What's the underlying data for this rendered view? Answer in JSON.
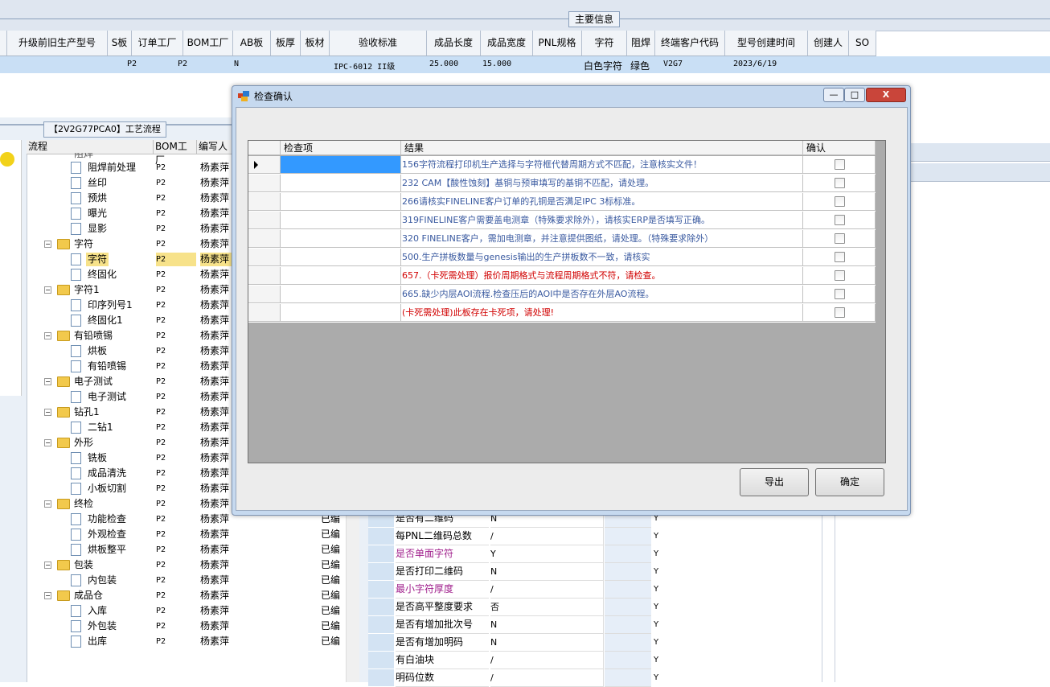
{
  "main_info_label": "主要信息",
  "columns": [
    "升级前旧生产型号",
    "S板",
    "订单工厂",
    "BOM工厂",
    "AB板",
    "板厚",
    "板材",
    "验收标准",
    "成品长度",
    "成品宽度",
    "PNL规格",
    "字符",
    "阻焊",
    "终端客户代码",
    "型号创建时间",
    "创建人",
    "SO"
  ],
  "row": {
    "order_factory": "P2",
    "bom_factory": "P2",
    "ab": "N",
    "standard": "IPC-6012 II级",
    "length": "25.000",
    "width": "15.000",
    "char": "白色字符",
    "solder": "绿色",
    "customer": "V2G7",
    "created": "2023/6/19"
  },
  "process_title": "【2V2G77PCA0】工艺流程",
  "tree_headers": [
    "流程",
    "BOM工厂",
    "编写人"
  ],
  "tree_partial": "阻焊",
  "tree": [
    {
      "name": "阻焊前处理",
      "level": 2,
      "bom": "P2",
      "editor": "杨素萍",
      "status": ""
    },
    {
      "name": "丝印",
      "level": 2,
      "bom": "P2",
      "editor": "杨素萍",
      "status": ""
    },
    {
      "name": "预烘",
      "level": 2,
      "bom": "P2",
      "editor": "杨素萍",
      "status": ""
    },
    {
      "name": "曝光",
      "level": 2,
      "bom": "P2",
      "editor": "杨素萍",
      "status": ""
    },
    {
      "name": "显影",
      "level": 2,
      "bom": "P2",
      "editor": "杨素萍",
      "status": ""
    },
    {
      "name": "字符",
      "level": 1,
      "bom": "P2",
      "editor": "杨素萍",
      "status": ""
    },
    {
      "name": "字符",
      "level": 2,
      "bom": "P2",
      "editor": "杨素萍",
      "status": "",
      "selected": true
    },
    {
      "name": "终固化",
      "level": 2,
      "bom": "P2",
      "editor": "杨素萍",
      "status": ""
    },
    {
      "name": "字符1",
      "level": 1,
      "bom": "P2",
      "editor": "杨素萍",
      "status": ""
    },
    {
      "name": "印序列号1",
      "level": 2,
      "bom": "P2",
      "editor": "杨素萍",
      "status": ""
    },
    {
      "name": "终固化1",
      "level": 2,
      "bom": "P2",
      "editor": "杨素萍",
      "status": ""
    },
    {
      "name": "有铅喷锡",
      "level": 1,
      "bom": "P2",
      "editor": "杨素萍",
      "status": ""
    },
    {
      "name": "烘板",
      "level": 2,
      "bom": "P2",
      "editor": "杨素萍",
      "status": ""
    },
    {
      "name": "有铅喷锡",
      "level": 2,
      "bom": "P2",
      "editor": "杨素萍",
      "status": ""
    },
    {
      "name": "电子测试",
      "level": 1,
      "bom": "P2",
      "editor": "杨素萍",
      "status": ""
    },
    {
      "name": "电子测试",
      "level": 2,
      "bom": "P2",
      "editor": "杨素萍",
      "status": ""
    },
    {
      "name": "钻孔1",
      "level": 1,
      "bom": "P2",
      "editor": "杨素萍",
      "status": ""
    },
    {
      "name": "二钻1",
      "level": 2,
      "bom": "P2",
      "editor": "杨素萍",
      "status": ""
    },
    {
      "name": "外形",
      "level": 1,
      "bom": "P2",
      "editor": "杨素萍",
      "status": ""
    },
    {
      "name": "铣板",
      "level": 2,
      "bom": "P2",
      "editor": "杨素萍",
      "status": ""
    },
    {
      "name": "成品清洗",
      "level": 2,
      "bom": "P2",
      "editor": "杨素萍",
      "status": ""
    },
    {
      "name": "小板切割",
      "level": 2,
      "bom": "P2",
      "editor": "杨素萍",
      "status": ""
    },
    {
      "name": "终检",
      "level": 1,
      "bom": "P2",
      "editor": "杨素萍",
      "status": ""
    },
    {
      "name": "功能检查",
      "level": 2,
      "bom": "P2",
      "editor": "杨素萍",
      "status": "已编写"
    },
    {
      "name": "外观检查",
      "level": 2,
      "bom": "P2",
      "editor": "杨素萍",
      "status": "已编写"
    },
    {
      "name": "烘板整平",
      "level": 2,
      "bom": "P2",
      "editor": "杨素萍",
      "status": "已编写"
    },
    {
      "name": "包装",
      "level": 1,
      "bom": "P2",
      "editor": "杨素萍",
      "status": "已编写"
    },
    {
      "name": "内包装",
      "level": 2,
      "bom": "P2",
      "editor": "杨素萍",
      "status": "已编写"
    },
    {
      "name": "成品仓",
      "level": 1,
      "bom": "P2",
      "editor": "杨素萍",
      "status": "已编写"
    },
    {
      "name": "入库",
      "level": 2,
      "bom": "P2",
      "editor": "杨素萍",
      "status": "已编写"
    },
    {
      "name": "外包装",
      "level": 2,
      "bom": "P2",
      "editor": "杨素萍",
      "status": "已编写"
    },
    {
      "name": "出库",
      "level": 2,
      "bom": "P2",
      "editor": "杨素萍",
      "status": "已编写"
    }
  ],
  "props": [
    {
      "label": "是否有二维码",
      "value": "N",
      "flag": "Y",
      "color": "#000"
    },
    {
      "label": "每PNL二维码总数",
      "value": "/",
      "flag": "Y",
      "color": "#000"
    },
    {
      "label": "是否单面字符",
      "value": "Y",
      "flag": "Y",
      "color": "#a0208c"
    },
    {
      "label": "是否打印二维码",
      "value": "N",
      "flag": "Y",
      "color": "#000"
    },
    {
      "label": "最小字符厚度",
      "value": "/",
      "flag": "Y",
      "color": "#a0208c"
    },
    {
      "label": "是否高平整度要求",
      "value": "否",
      "flag": "Y",
      "color": "#000"
    },
    {
      "label": "是否有增加批次号",
      "value": "N",
      "flag": "Y",
      "color": "#000"
    },
    {
      "label": "是否有增加明码",
      "value": "N",
      "flag": "Y",
      "color": "#000"
    },
    {
      "label": "有白油块",
      "value": "/",
      "flag": "Y",
      "color": "#000"
    },
    {
      "label": "明码位数",
      "value": "/",
      "flag": "Y",
      "color": "#000"
    }
  ],
  "dialog": {
    "title": "检查确认",
    "col_item": "检查项",
    "col_result": "结果",
    "col_confirm": "确认",
    "rows": [
      {
        "result": "156字符流程打印机生产选择与字符框代替周期方式不匹配，注意核实文件！",
        "color": "blue"
      },
      {
        "result": "232 CAM【酸性蚀刻】基铜与预审填写的基铜不匹配，请处理。",
        "color": "blue"
      },
      {
        "result": "266请核实FINELINE客户订单的孔铜是否满足IPC 3标标准。",
        "color": "blue"
      },
      {
        "result": "319FINELINE客户需要盖电测章（特殊要求除外），请核实ERP是否填写正确。",
        "color": "blue"
      },
      {
        "result": "320 FINELINE客户，需加电测章，并注意提供图纸，请处理。（特殊要求除外）",
        "color": "blue"
      },
      {
        "result": "500.生产拼板数量与genesis输出的生产拼板数不一致，请核实",
        "color": "blue"
      },
      {
        "result": "657.（卡死需处理）报价周期格式与流程周期格式不符，请检查。",
        "color": "red"
      },
      {
        "result": "665.缺少内层AOI流程.检查压后的AOI中是否存在外层AO流程。",
        "color": "blue"
      },
      {
        "result": "(卡死需处理)此板存在卡死项，请处理!",
        "color": "red"
      }
    ],
    "export_label": "导出",
    "ok_label": "确定",
    "minimize": "—",
    "maximize": "□",
    "close": "X"
  }
}
